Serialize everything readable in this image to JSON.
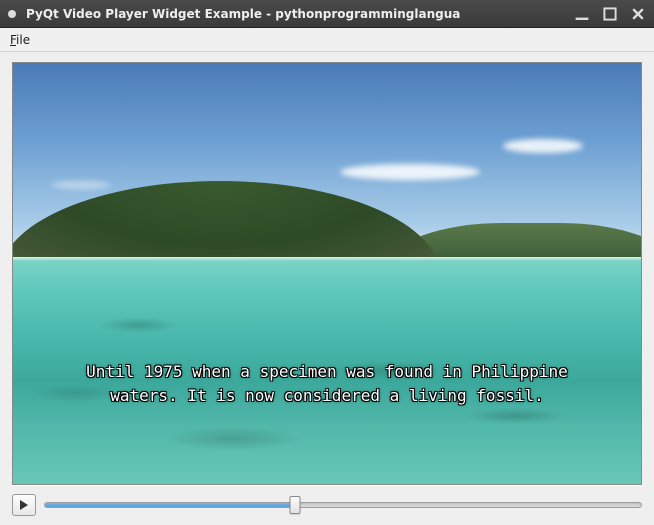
{
  "window": {
    "title": "PyQt Video Player Widget Example - pythonprogramminglangua"
  },
  "menubar": {
    "file_label": "File",
    "file_mnemonic": "F"
  },
  "video": {
    "subtitle_text": "Until 1975 when a specimen was found in Philippine\nwaters. It is now considered a living fossil."
  },
  "player": {
    "play_icon": "play-icon",
    "progress_percent": 42
  },
  "colors": {
    "slider_fill": "#5a9dd8",
    "titlebar": "#3a3a3a"
  }
}
